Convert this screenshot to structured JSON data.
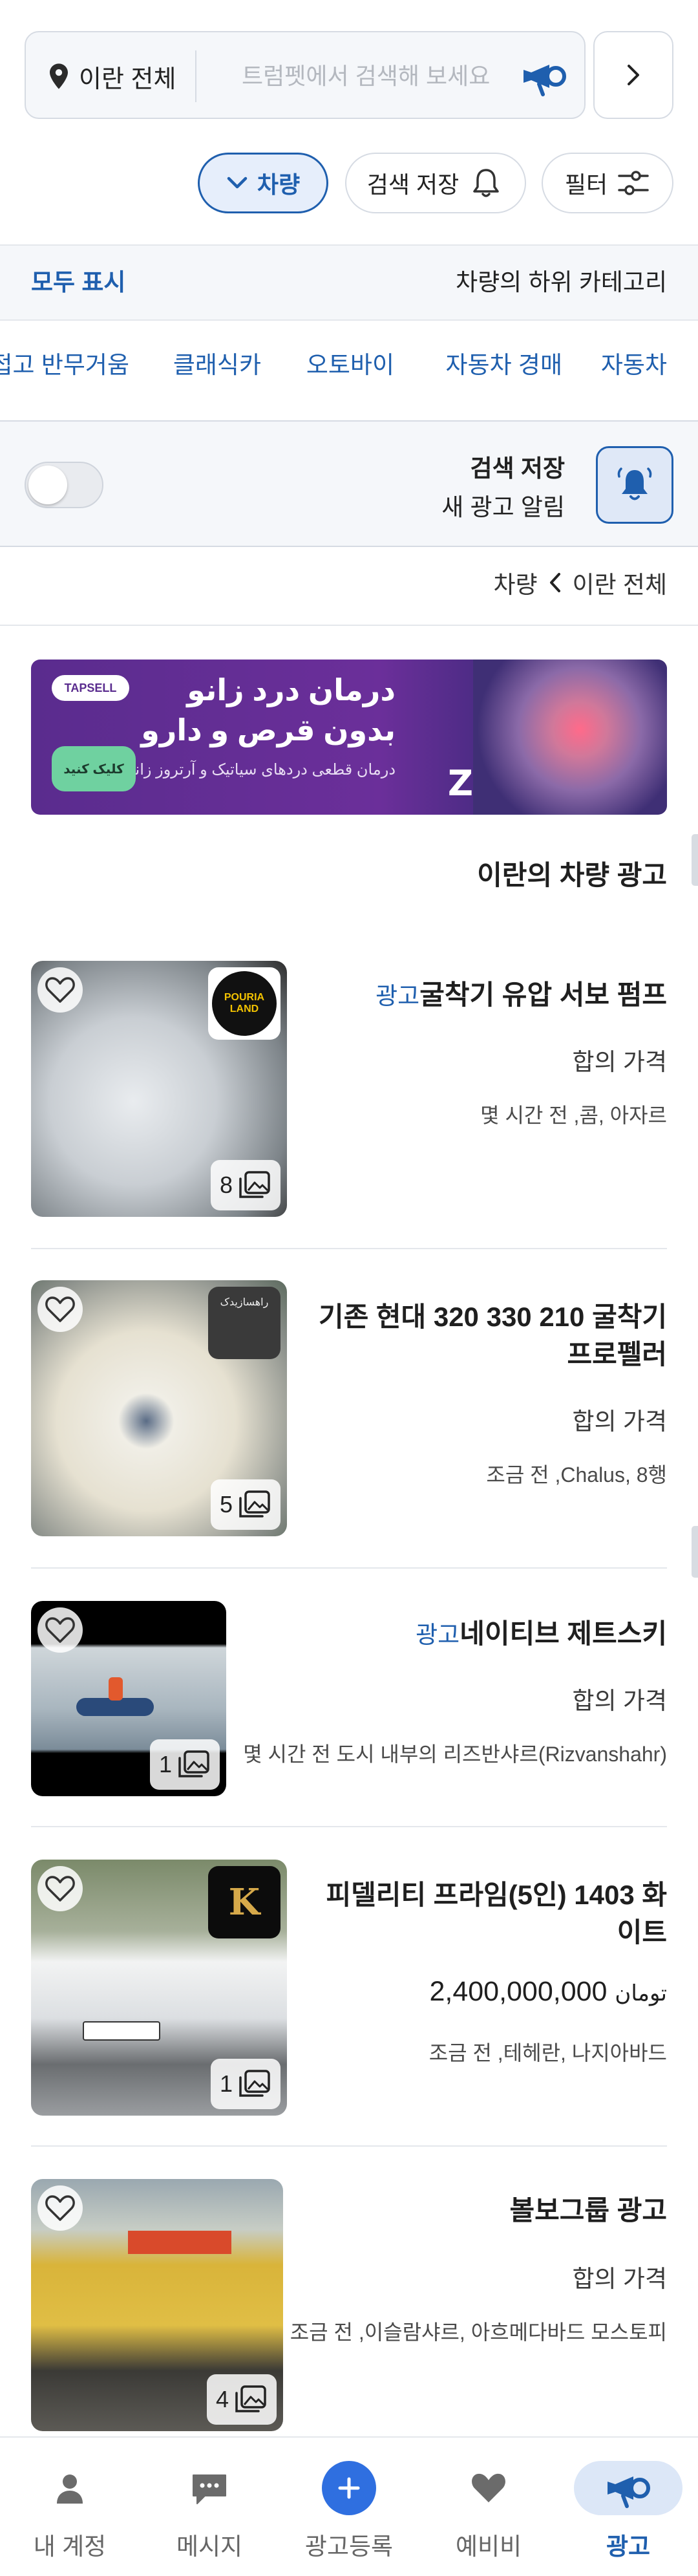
{
  "search": {
    "location": "이란 전체",
    "placeholder": "트럼펫에서 검색해 보세요"
  },
  "chips": {
    "category": "차량",
    "save_search": "검색 저장",
    "filter": "필터"
  },
  "subcategories": {
    "show_all": "모두 표시",
    "title": "차량의 하위 카테고리",
    "items": [
      "자동차",
      "자동차 경매",
      "오토바이",
      "클래식카",
      "접고 반무거움"
    ]
  },
  "saved_search": {
    "title": "검색 저장",
    "subtitle": "새 광고 알림",
    "enabled": false
  },
  "breadcrumb": {
    "root": "이란 전체",
    "current": "차량"
  },
  "banner": {
    "line1": "درمان درد زانو",
    "line2": "بدون قرص و دارو",
    "line3": "درمان قطعی دردهای سیاتیک و آرتروز زانو",
    "cta": "کلیک کنید",
    "brand": "TAPSELL"
  },
  "section_title": "이란의 차량 광고",
  "listings": [
    {
      "title": "굴착기 유압 서보 펌프",
      "ad_label": "광고",
      "price": "합의 가격",
      "meta": "몇 시간 전 ,콤, 아자르",
      "photo_count": "8",
      "shop_logo": "POURIA LAND"
    },
    {
      "title_line1": "기존 현대 320 330 210 굴착기",
      "title_line2": "프로펠러",
      "price": "합의 가격",
      "meta": "조금 전 ,Chalus, 8행",
      "photo_count": "5",
      "shop_logo": "راهسازیدک"
    },
    {
      "title": "네이티브 제트스키",
      "ad_label": "광고",
      "price": "합의 가격",
      "meta": "몇 시간 전 도시 내부의 리즈반샤르(Rizvanshahr)",
      "photo_count": "1"
    },
    {
      "title_line1": "피델리티 프라임(5인) 1403 화",
      "title_line2": "이트",
      "price": "2,400,000,000",
      "currency": "تومان",
      "meta": "조금 전 ,테헤란, 나지아바드",
      "photo_count": "1",
      "shop_logo": "K"
    },
    {
      "title": "볼보그룹 광고",
      "price": "합의 가격",
      "meta": "조금 전 ,이슬람샤르, 아흐메다바드 모스토피",
      "photo_count": "4"
    }
  ],
  "bottom_nav": [
    {
      "label": "내 계정",
      "icon": "person-icon"
    },
    {
      "label": "메시지",
      "icon": "chat-icon"
    },
    {
      "label": "광고등록",
      "icon": "plus-icon"
    },
    {
      "label": "예비비",
      "icon": "heart-icon"
    },
    {
      "label": "광고",
      "icon": "trumpet-icon",
      "active": true
    }
  ],
  "colors": {
    "accent": "#1f5fae",
    "accent_bg": "#dce7f7",
    "border": "#d6dbe3",
    "panel_bg": "#f5f7fa"
  }
}
